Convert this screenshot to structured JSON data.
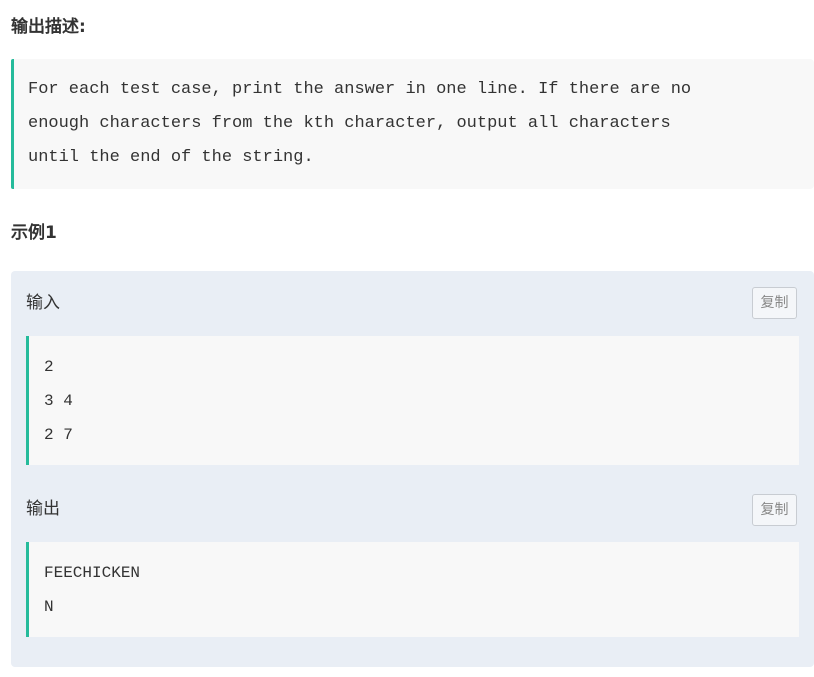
{
  "output_description": {
    "title": "输出描述:",
    "text": "For each test case, print the answer in one line. If there are no\nenough characters from the kth character, output all characters\nuntil the end of the string."
  },
  "example": {
    "title": "示例1",
    "input": {
      "label": "输入",
      "copy_label": "复制",
      "lines": [
        "2",
        "3 4",
        "2 7"
      ]
    },
    "output": {
      "label": "输出",
      "copy_label": "复制",
      "lines": [
        "FEECHICKEN",
        "N"
      ]
    }
  },
  "colors": {
    "accent": "#25bb9b",
    "card_background": "#e9eef5",
    "code_background": "#f8f8f8"
  }
}
